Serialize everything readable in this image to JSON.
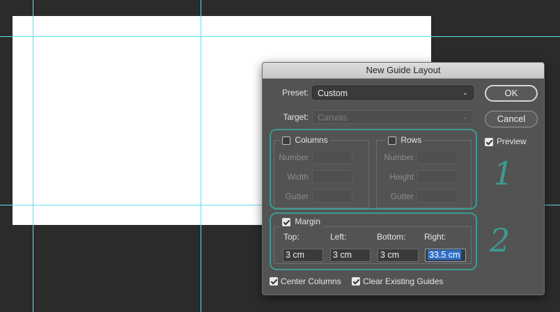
{
  "dialog": {
    "title": "New Guide Layout",
    "preset": {
      "label": "Preset:",
      "value": "Custom"
    },
    "target": {
      "label": "Target:",
      "value": "Canvas"
    },
    "ok_label": "OK",
    "cancel_label": "Cancel",
    "preview": {
      "label": "Preview",
      "checked": true
    },
    "columns": {
      "label": "Columns",
      "checked": false,
      "fields": [
        {
          "label": "Number"
        },
        {
          "label": "Width"
        },
        {
          "label": "Gutter"
        }
      ]
    },
    "rows": {
      "label": "Rows",
      "checked": false,
      "fields": [
        {
          "label": "Number"
        },
        {
          "label": "Height"
        },
        {
          "label": "Gutter"
        }
      ]
    },
    "margin": {
      "label": "Margin",
      "checked": true,
      "top": {
        "label": "Top:",
        "value": "3 cm"
      },
      "left": {
        "label": "Left:",
        "value": "3 cm"
      },
      "bottom": {
        "label": "Bottom:",
        "value": "3 cm"
      },
      "right": {
        "label": "Right:",
        "value": "33.5 cm"
      }
    },
    "center_columns": {
      "label": "Center Columns",
      "checked": true
    },
    "clear_guides": {
      "label": "Clear Existing Guides",
      "checked": true
    }
  },
  "annotations": {
    "callout_1": "1",
    "callout_2": "2"
  },
  "colors": {
    "guide": "#5ee0e6",
    "callout": "#3f9a8f",
    "selection": "#2f6fc7"
  },
  "icons": {
    "dropdown": "chevron-down-icon",
    "checkbox": "checkmark-icon"
  }
}
